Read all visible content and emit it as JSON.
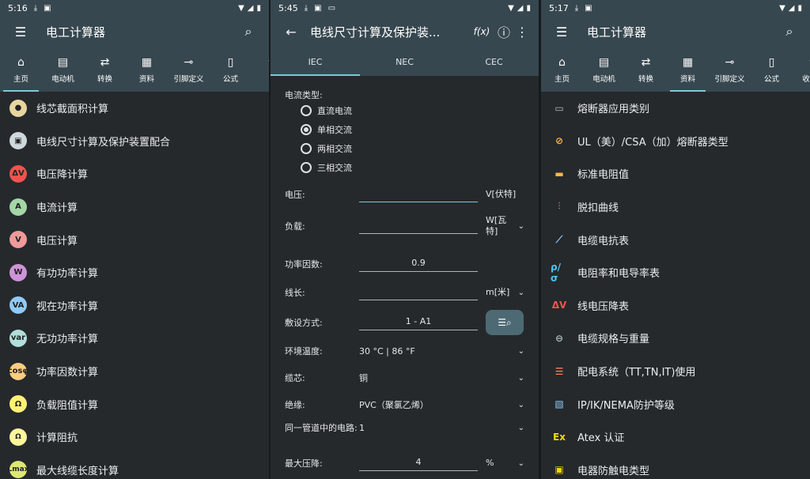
{
  "panel1": {
    "status": {
      "time": "5:16"
    },
    "appbar": {
      "title": "电工计算器"
    },
    "tabs": [
      {
        "icon": "home-icon",
        "glyph": "⌂",
        "label": "主页",
        "active": true
      },
      {
        "icon": "motor-icon",
        "glyph": "▤",
        "label": "电动机"
      },
      {
        "icon": "convert-icon",
        "glyph": "⇄",
        "label": "转换"
      },
      {
        "icon": "resources-icon",
        "glyph": "▦",
        "label": "资料"
      },
      {
        "icon": "pinout-icon",
        "glyph": "⊸",
        "label": "引脚定义"
      },
      {
        "icon": "formula-icon",
        "glyph": "▯",
        "label": "公式"
      },
      {
        "icon": "favorites-icon",
        "glyph": "☆",
        "label": "收"
      }
    ],
    "items": [
      {
        "label": "线芯截面积计算",
        "glyph": "●",
        "bg": "#e8d5a0"
      },
      {
        "label": "电线尺寸计算及保护装置配合",
        "glyph": "▣",
        "bg": "#cfd8dc"
      },
      {
        "label": "电压降计算",
        "glyph": "ΔV",
        "bg": "#ef5350"
      },
      {
        "label": "电流计算",
        "glyph": "A",
        "bg": "#a5d6a7"
      },
      {
        "label": "电压计算",
        "glyph": "V",
        "bg": "#ef9a9a"
      },
      {
        "label": "有功功率计算",
        "glyph": "W",
        "bg": "#ce93d8"
      },
      {
        "label": "视在功率计算",
        "glyph": "VA",
        "bg": "#90caf9"
      },
      {
        "label": "无功功率计算",
        "glyph": "var",
        "bg": "#b2dfdb"
      },
      {
        "label": "功率因数计算",
        "glyph": "cosφ",
        "bg": "#ffcc80"
      },
      {
        "label": "负载阻值计算",
        "glyph": "Ω",
        "bg": "#fff176"
      },
      {
        "label": "计算阻抗",
        "glyph": "Ω",
        "bg": "#fff59d"
      },
      {
        "label": "最大线缆长度计算",
        "glyph": "Lmax",
        "bg": "#dce775"
      }
    ]
  },
  "panel2": {
    "status": {
      "time": "5:45"
    },
    "appbar": {
      "title": "电线尺寸计算及保护装...",
      "fx": "f(x)"
    },
    "tabs": [
      "IEC",
      "NEC",
      "CEC"
    ],
    "current_type_label": "电流类型:",
    "radios": [
      {
        "label": "直流电流",
        "checked": false
      },
      {
        "label": "单相交流",
        "checked": true
      },
      {
        "label": "两相交流",
        "checked": false
      },
      {
        "label": "三相交流",
        "checked": false
      }
    ],
    "fields": {
      "voltage": {
        "label": "电压:",
        "value": "",
        "unit": "V[伏特]"
      },
      "load": {
        "label": "负载:",
        "value": "",
        "unit": "W[瓦特]"
      },
      "pf": {
        "label": "功率因数:",
        "value": "0.9"
      },
      "length": {
        "label": "线长:",
        "value": "",
        "unit": "m[米]"
      },
      "install": {
        "label": "敷设方式:",
        "value": "1 - A1"
      },
      "temp": {
        "label": "环境温度:",
        "value": "30 °C | 86 °F"
      },
      "core": {
        "label": "缆芯:",
        "value": "铜"
      },
      "insul": {
        "label": "绝缘:",
        "value": "PVC（聚氯乙烯）"
      },
      "circuits": {
        "label": "同一管道中的电路:",
        "value": "1"
      },
      "maxdrop": {
        "label": "最大压降:",
        "value": "4",
        "unit": "%"
      }
    }
  },
  "panel3": {
    "status": {
      "time": "5:17"
    },
    "appbar": {
      "title": "电工计算器"
    },
    "tabs": [
      {
        "icon": "home-icon",
        "glyph": "⌂",
        "label": "主页"
      },
      {
        "icon": "motor-icon",
        "glyph": "▤",
        "label": "电动机"
      },
      {
        "icon": "convert-icon",
        "glyph": "⇄",
        "label": "转换"
      },
      {
        "icon": "resources-icon",
        "glyph": "▦",
        "label": "资料",
        "active": true
      },
      {
        "icon": "pinout-icon",
        "glyph": "⊸",
        "label": "引脚定义"
      },
      {
        "icon": "formula-icon",
        "glyph": "▯",
        "label": "公式"
      },
      {
        "icon": "favorites-icon",
        "glyph": "☆",
        "label": "收藏夹"
      }
    ],
    "items": [
      {
        "label": "熔断器应用类别",
        "glyph": "▭",
        "color": "#b0bec5"
      },
      {
        "label": "UL（美）/CSA（加）熔断器类型",
        "glyph": "⊘",
        "color": "#ffb74d"
      },
      {
        "label": "标准电阻值",
        "glyph": "▬",
        "color": "#ffb74d"
      },
      {
        "label": "脱扣曲线",
        "glyph": "⫶",
        "color": "#8d6e63"
      },
      {
        "label": "电缆电抗表",
        "glyph": "⟋",
        "color": "#90caf9"
      },
      {
        "label": "电阻率和电导率表",
        "glyph": "ρ/σ",
        "color": "#4fc3f7"
      },
      {
        "label": "线电压降表",
        "glyph": "ΔV",
        "color": "#ef5350"
      },
      {
        "label": "电缆规格与重量",
        "glyph": "⊖",
        "color": "#b0bec5"
      },
      {
        "label": "配电系统（TT,TN,IT)使用",
        "glyph": "☰",
        "color": "#ff8a65"
      },
      {
        "label": "IP/IK/NEMA防护等级",
        "glyph": "▧",
        "color": "#90caf9"
      },
      {
        "label": "Atex 认证",
        "glyph": "Ex",
        "color": "#ffd600"
      },
      {
        "label": "电器防触电类型",
        "glyph": "▣",
        "color": "#ffd600"
      }
    ]
  }
}
